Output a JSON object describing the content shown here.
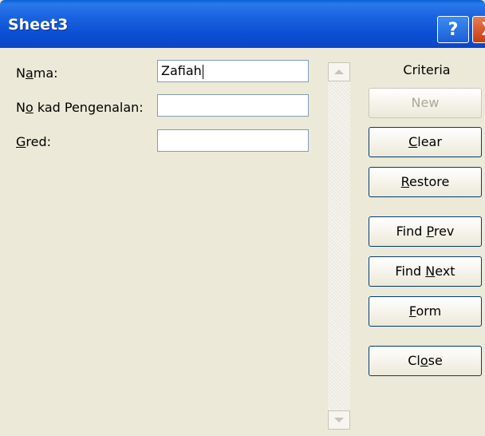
{
  "window": {
    "title": "Sheet3",
    "help_label": "?",
    "close_label": "X"
  },
  "fields": [
    {
      "label_pre": "N",
      "label_key": "a",
      "label_post": "ma:",
      "value": "Zafiah"
    },
    {
      "label_pre": "N",
      "label_key": "o",
      "label_post": " kad Pengenalan:",
      "value": ""
    },
    {
      "label_pre": "",
      "label_key": "G",
      "label_post": "red:",
      "value": ""
    }
  ],
  "sidebar": {
    "criteria": "Criteria",
    "buttons": [
      {
        "pre": "",
        "key": "",
        "post": "New",
        "enabled": false
      },
      {
        "pre": "",
        "key": "C",
        "post": "lear",
        "enabled": true
      },
      {
        "pre": "",
        "key": "R",
        "post": "estore",
        "enabled": true
      },
      {
        "pre": "Find ",
        "key": "P",
        "post": "rev",
        "enabled": true
      },
      {
        "pre": "Find ",
        "key": "N",
        "post": "ext",
        "enabled": true
      },
      {
        "pre": "",
        "key": "F",
        "post": "orm",
        "enabled": true
      },
      {
        "pre": "Cl",
        "key": "o",
        "post": "se",
        "enabled": true
      }
    ]
  },
  "scrollbar": {
    "up_icon": "scroll-up-arrow",
    "down_icon": "scroll-down-arrow"
  }
}
